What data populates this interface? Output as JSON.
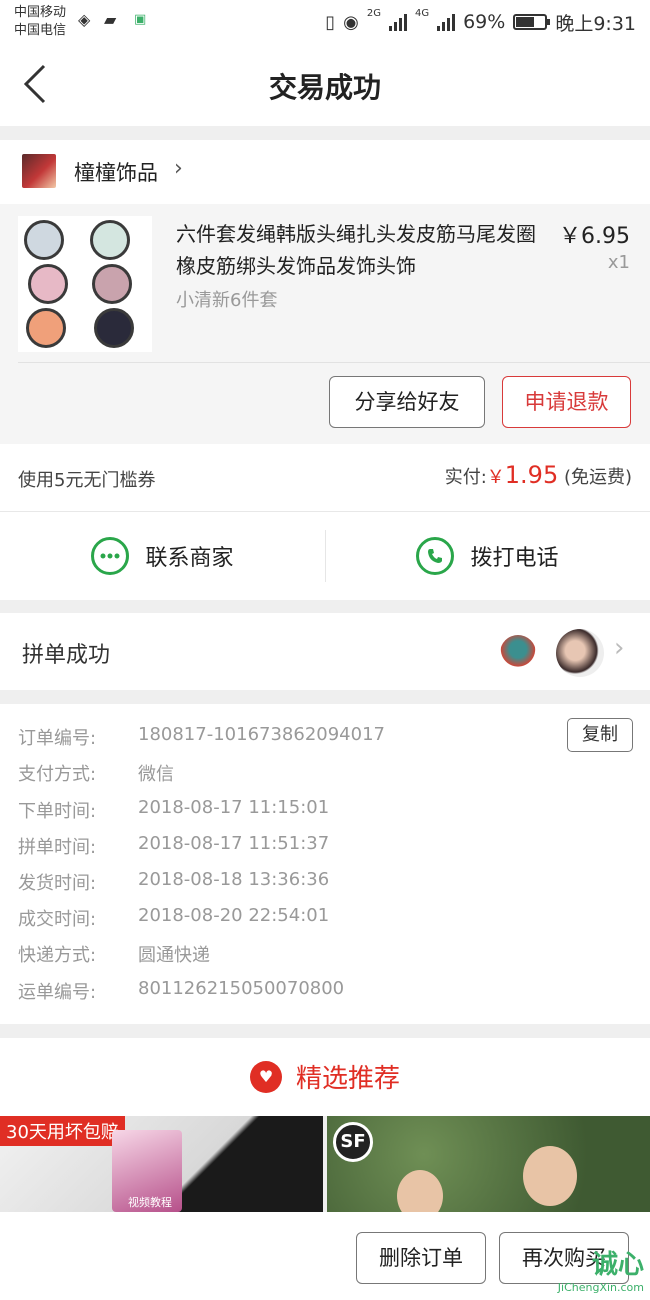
{
  "status_bar": {
    "carrier1": "中国移动",
    "carrier2": "中国电信",
    "signal1": "2G",
    "signal2": "4G",
    "battery_text": "69%",
    "battery_level": 0.69,
    "time": "晚上9:31"
  },
  "nav": {
    "title": "交易成功"
  },
  "shop": {
    "name": "橦橦饰品"
  },
  "product": {
    "title": "六件套发绳韩版头绳扎头发皮筋马尾发圈橡皮筋绑头发饰品发饰头饰",
    "sku": "小清新6件套",
    "price": "￥6.95",
    "qty": "x1",
    "share_label": "分享给好友",
    "refund_label": "申请退款"
  },
  "payment": {
    "coupon": "使用5元无门槛券",
    "paid_label": "实付:",
    "currency": "￥",
    "amount": "1.95",
    "shipping_note": "(免运费)"
  },
  "contact": {
    "merchant_label": "联系商家",
    "call_label": "拨打电话"
  },
  "group": {
    "title": "拼单成功"
  },
  "order": {
    "copy_label": "复制",
    "rows": [
      {
        "label": "订单编号:",
        "value": "180817-101673862094017"
      },
      {
        "label": "支付方式:",
        "value": "微信"
      },
      {
        "label": "下单时间:",
        "value": "2018-08-17 11:15:01"
      },
      {
        "label": "拼单时间:",
        "value": "2018-08-17 11:51:37"
      },
      {
        "label": "发货时间:",
        "value": "2018-08-18 13:36:36"
      },
      {
        "label": "成交时间:",
        "value": "2018-08-20 22:54:01"
      },
      {
        "label": "快递方式:",
        "value": "圆通快递"
      },
      {
        "label": "运单编号:",
        "value": "801126215050070800"
      }
    ]
  },
  "recommend": {
    "title": "精选推荐",
    "left_badge": "30天用坏包赔",
    "left_book_label": "视频教程",
    "right_logo": "SF"
  },
  "bottom": {
    "delete_label": "删除订单",
    "rebuy_label": "再次购买"
  },
  "watermark": {
    "main": "诚心",
    "sub": "JiChengXin.com"
  },
  "colors": {
    "accent_red": "#e02e24",
    "green": "#2aa64a"
  }
}
